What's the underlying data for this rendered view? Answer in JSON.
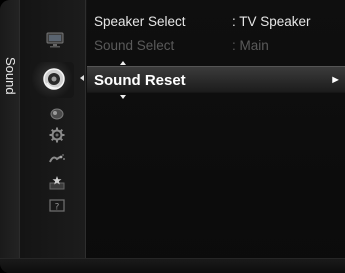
{
  "category": {
    "label": "Sound"
  },
  "icons": [
    "picture-icon",
    "sound-icon",
    "channel-icon",
    "setup-icon",
    "input-icon",
    "application-icon",
    "support-icon"
  ],
  "menu": {
    "items": [
      {
        "label": "Speaker Select",
        "value": ": TV Speaker",
        "state": "enabled"
      },
      {
        "label": "Sound Select",
        "value": ": Main",
        "state": "disabled"
      },
      {
        "label": "Sound Reset",
        "value": "",
        "state": "selected",
        "submenu_arrow": "►"
      }
    ]
  },
  "colors": {
    "text": "#e6e6e6",
    "disabled_text": "#5a5a5a",
    "highlight": "#2e2e2e",
    "background": "#0e0e0e"
  }
}
